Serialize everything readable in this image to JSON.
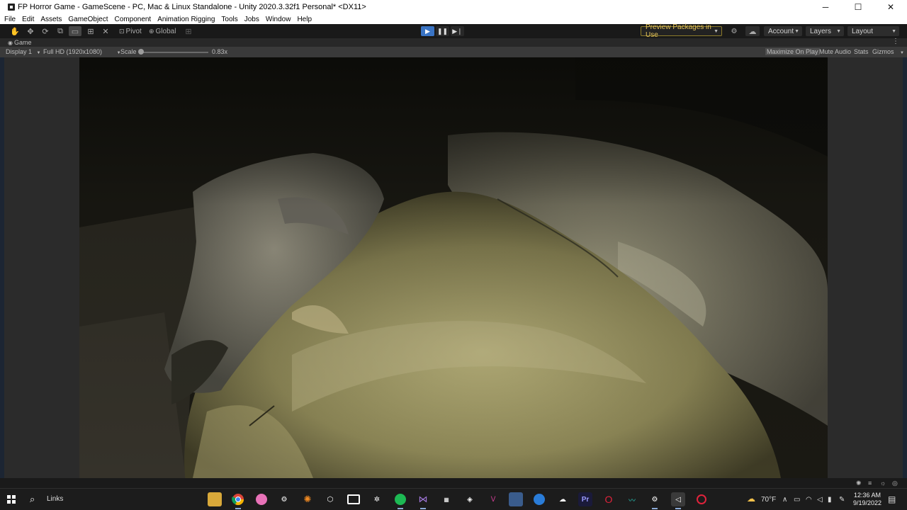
{
  "window": {
    "title": "FP Horror Game - GameScene - PC, Mac & Linux Standalone - Unity 2020.3.32f1 Personal* <DX11>",
    "minimize": "─",
    "maximize": "☐",
    "close": "✕"
  },
  "menu": [
    "File",
    "Edit",
    "Assets",
    "GameObject",
    "Component",
    "Animation Rigging",
    "Tools",
    "Jobs",
    "Window",
    "Help"
  ],
  "toolbar": {
    "pivot_label": "Pivot",
    "global_label": "Global",
    "preview_packages": "Preview Packages in Use",
    "account": "Account",
    "layers": "Layers",
    "layout": "Layout",
    "play_state": "playing"
  },
  "game_tab": {
    "tab_label": "Game",
    "display": "Display 1",
    "resolution": "Full HD (1920x1080)",
    "scale_label": "Scale",
    "scale_value": "0.83x",
    "scale_fraction": 0.05,
    "maximize_on_play": "Maximize On Play",
    "mute_audio": "Mute Audio",
    "stats": "Stats",
    "gizmos": "Gizmos"
  },
  "taskbar": {
    "search_label": "Links",
    "weather": "70°F",
    "time": "12:36 AM",
    "date": "9/19/2022"
  },
  "colors": {
    "play_active": "#3a74c4",
    "preview_packages_text": "#e3c25a",
    "scene_cloth": "#b9b27a",
    "scene_dark": "#141310"
  }
}
